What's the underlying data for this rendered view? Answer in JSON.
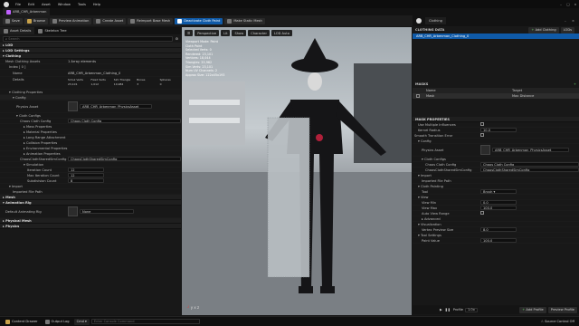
{
  "menu": {
    "items": [
      "File",
      "Edit",
      "Asset",
      "Window",
      "Tools",
      "Help"
    ],
    "doc_tab": "ARB_CHR_Arbenman"
  },
  "toolbar": {
    "save": "Save",
    "browse": "Browse",
    "preview_animation": "Preview Animation",
    "create_asset": "Create Asset",
    "reimport_base_mesh": "Reimport Base Mesh",
    "deactivate_cloth_paint": "Deactivate Cloth Paint",
    "make_static_mesh": "Make Static Mesh"
  },
  "left": {
    "tabs": [
      "Asset Details",
      "Skeleton Tree"
    ],
    "search_placeholder": "Search",
    "sections": {
      "lod": "LOD",
      "lod_settings": "LOD Settings",
      "clothing": "Clothing",
      "mesh_clothing_assets": "Mesh Clothing Assets",
      "mesh_clothing_count": "1 Array elements",
      "index0": "Index [ 0 ]",
      "name_label": "Name",
      "name_value": "ARB_CHR_Arbenman_Clothing_0",
      "details_label": "Details",
      "details_headers": [
        "Simul Verts",
        "Fixed Verts",
        "Sim Triangle",
        "Bones",
        "Spheres"
      ],
      "details_values": [
        "23,101",
        "1,012",
        "10,984",
        "3",
        "0"
      ],
      "clothing_properties": "Clothing Properties",
      "config": "Config",
      "physics_asset": "Physics Asset",
      "physics_asset_value": "ARB_CHR_Arbenman_PhysicsAsset",
      "cloth_configs": "Cloth Configs",
      "cloth_configs_value": "Chaos Cloth Config",
      "shared_config_value": "ChaosClothSharedSimConfig",
      "mass_props": "Mass Properties",
      "material_props": "Material Properties",
      "long_range": "Long Range Attachment",
      "collision_props": "Collision Properties",
      "env_props": "Environmental Properties",
      "anim_props": "Animation Properties",
      "chaos_shared": "ChaosClothSharedSimConfig",
      "simulation": "Simulation",
      "iteration_count": "Iteration Count",
      "iteration_count_value": "12",
      "max_iter": "Max Iteration Count",
      "max_iter_value": "12",
      "substep": "Subdivision Count",
      "substep_value": "8",
      "import": "Import",
      "imported_file": "Imported File Path",
      "imported_file_value": "",
      "mesh": "Mesh",
      "animation_rig": "Animation Rig",
      "default_rig": "Default Animating Rig",
      "default_rig_value": "None",
      "physical_mesh": "Physical Mesh",
      "physics": "Physics"
    }
  },
  "viewport": {
    "buttons": [
      "Perspective",
      "Lit",
      "Show",
      "Character",
      "LOD Auto"
    ],
    "stats": [
      "Viewport Mode: Paint",
      "Cloth Paint",
      "Selected Verts: 0",
      "Rendered: 23,101",
      "Vertices: 18,044",
      "Triangles: 35,962",
      "Sim Verts: 23,101",
      "Num UV Channels: 2",
      "Approx Size: 122x45x193"
    ],
    "axis": "y x z",
    "zoom": "1.0x"
  },
  "right": {
    "tab": "Clothing",
    "clothing_data": "CLOTHING DATA",
    "add_clothing": "Add Clothing",
    "lods_button": "LODs",
    "asset_row": "ARB_CHR_Arbenman_Clothing_0",
    "masks": "MASKS",
    "mask_headers": [
      "Name",
      "Target"
    ],
    "mask_row": {
      "name": "Mask",
      "target": "Max Distance"
    },
    "mask_props": "MASK PROPERTIES",
    "use_multiple": "Use Multiple Influences",
    "kernel_radius": "Kernel Radius",
    "kernel_value": "10.0",
    "smooth_transition": "Smooth Transition Error",
    "config": "Config",
    "physics_asset": "Physics Asset",
    "physics_asset_value": "ARB_CHR_Arbenman_PhysicsAsset",
    "cloth_configs": "Cloth Configs",
    "cloth_configs_values": [
      "Chaos Cloth Config",
      "ChaosClothSharedSimConfig"
    ],
    "import": "Import",
    "imported_file": "Imported File Path",
    "cloth_painting": "Cloth Painting",
    "tool": "Tool",
    "tool_value": "Brush",
    "view": "View",
    "view_min": "View Min",
    "view_min_value": "0.0",
    "view_max": "View Max",
    "view_max_value": "100.0",
    "auto_view": "Auto View Range",
    "advanced": "Advanced",
    "visualization": "Visualization",
    "vertex_preview": "Vertex Preview Size",
    "vertex_preview_value": "8.0",
    "tool_settings": "Tool Settings",
    "paint_value": "Paint Value",
    "paint_value_number": "100.0",
    "add_profile": "Add Profile",
    "preview_profile": "Preview Profile"
  },
  "bottom": {
    "content_drawer": "Content Drawer",
    "output_log": "Output Log",
    "cmd": "Cmd",
    "console_placeholder": "Enter Console Command",
    "anim_profile": "Profile",
    "speed": "1.0x",
    "source_control": "Source Control Off"
  }
}
